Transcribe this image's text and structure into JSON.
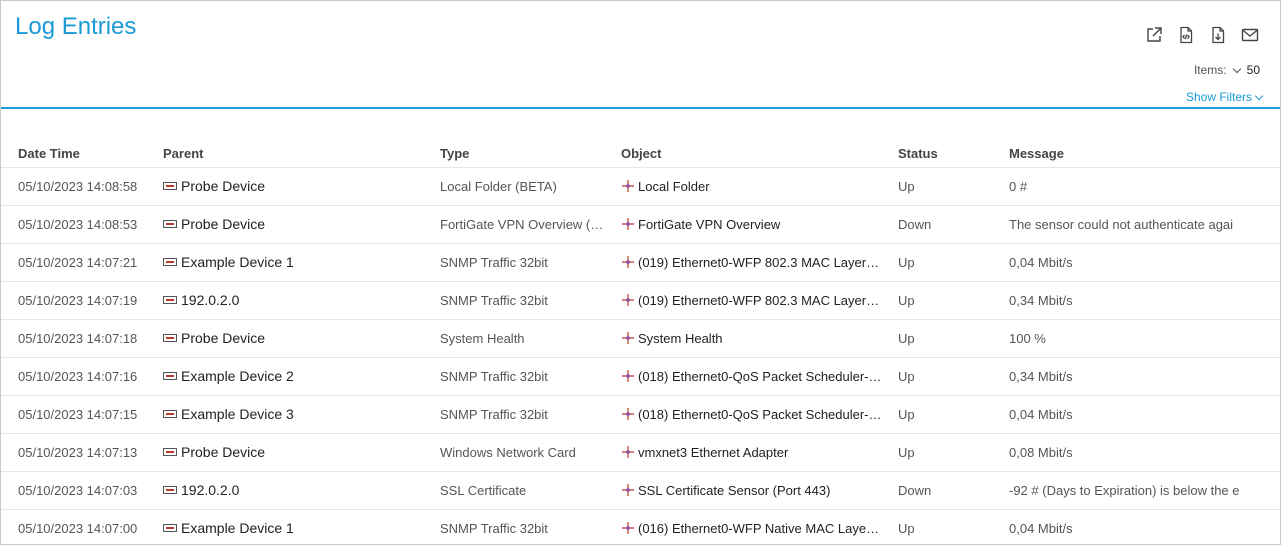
{
  "page": {
    "title": "Log Entries"
  },
  "toolbar": {
    "icons": [
      "external-link-icon",
      "xml-export-icon",
      "csv-export-icon",
      "mail-icon"
    ]
  },
  "items": {
    "label": "Items:",
    "value": "50"
  },
  "filters": {
    "label": "Show Filters"
  },
  "colors": {
    "accent": "#1a9ad6"
  },
  "table": {
    "headers": {
      "datetime": "Date Time",
      "parent": "Parent",
      "type": "Type",
      "object": "Object",
      "status": "Status",
      "message": "Message"
    },
    "rows": [
      {
        "datetime": "05/10/2023 14:08:58",
        "parent": "Probe Device",
        "type": "Local Folder (BETA)",
        "object": "Local Folder",
        "status": "Up",
        "message": "0 #"
      },
      {
        "datetime": "05/10/2023 14:08:53",
        "parent": "Probe Device",
        "type": "FortiGate VPN Overview (…",
        "object": "FortiGate VPN Overview",
        "status": "Down",
        "message": "The sensor could not authenticate agai"
      },
      {
        "datetime": "05/10/2023 14:07:21",
        "parent": "Example Device 1",
        "type": "SNMP Traffic 32bit",
        "object": "(019) Ethernet0-WFP 802.3 MAC Layer …",
        "status": "Up",
        "message": "0,04 Mbit/s"
      },
      {
        "datetime": "05/10/2023 14:07:19",
        "parent": "192.0.2.0",
        "type": "SNMP Traffic 32bit",
        "object": "(019) Ethernet0-WFP 802.3 MAC Layer …",
        "status": "Up",
        "message": "0,34 Mbit/s"
      },
      {
        "datetime": "05/10/2023 14:07:18",
        "parent": "Probe Device",
        "type": "System Health",
        "object": "System Health",
        "status": "Up",
        "message": "100 %"
      },
      {
        "datetime": "05/10/2023 14:07:16",
        "parent": "Example Device 2",
        "type": "SNMP Traffic 32bit",
        "object": "(018) Ethernet0-QoS Packet Scheduler-…",
        "status": "Up",
        "message": "0,34 Mbit/s"
      },
      {
        "datetime": "05/10/2023 14:07:15",
        "parent": "Example Device 3",
        "type": "SNMP Traffic 32bit",
        "object": "(018) Ethernet0-QoS Packet Scheduler-…",
        "status": "Up",
        "message": "0,04 Mbit/s"
      },
      {
        "datetime": "05/10/2023 14:07:13",
        "parent": "Probe Device",
        "type": "Windows Network Card",
        "object": "vmxnet3 Ethernet Adapter",
        "status": "Up",
        "message": "0,08 Mbit/s"
      },
      {
        "datetime": "05/10/2023 14:07:03",
        "parent": "192.0.2.0",
        "type": "SSL Certificate",
        "object": "SSL Certificate Sensor (Port 443)",
        "status": "Down",
        "message": "-92 # (Days to Expiration) is below the e"
      },
      {
        "datetime": "05/10/2023 14:07:00",
        "parent": "Example Device 1",
        "type": "SNMP Traffic 32bit",
        "object": "(016) Ethernet0-WFP Native MAC Layer…",
        "status": "Up",
        "message": "0,04 Mbit/s"
      }
    ]
  }
}
